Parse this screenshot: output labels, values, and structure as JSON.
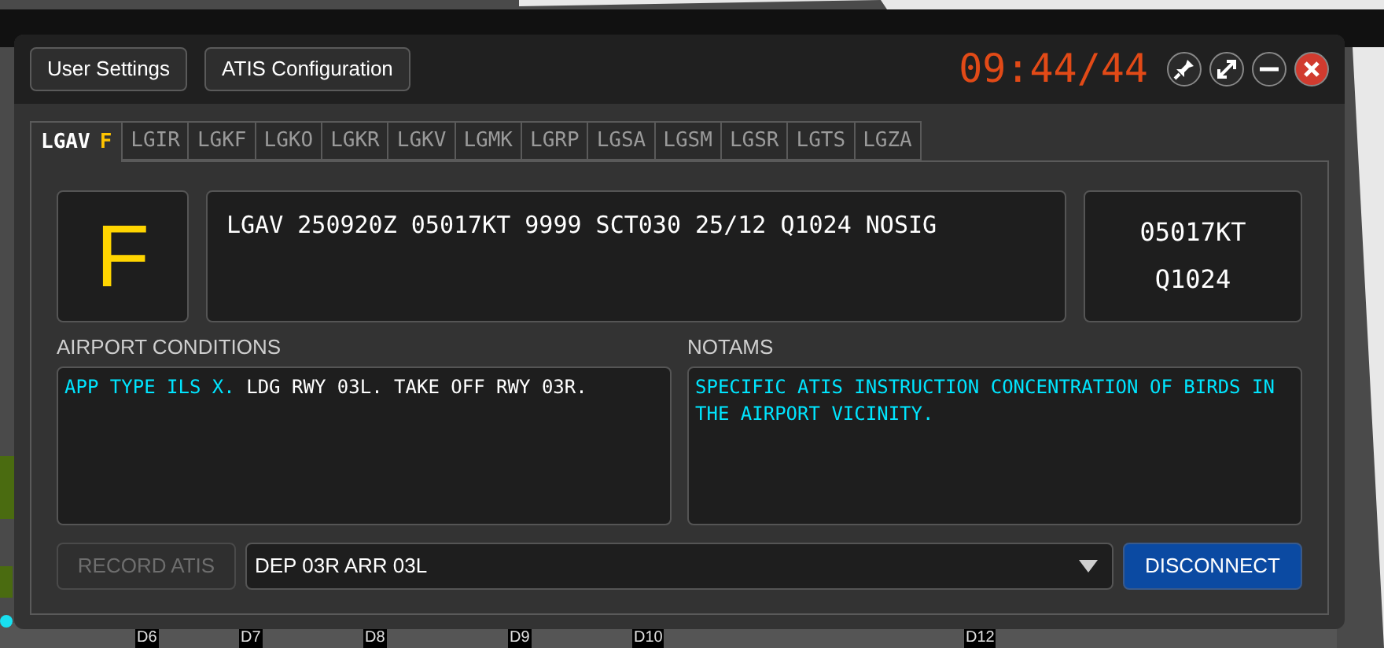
{
  "background": {
    "map_labels": [
      "D6",
      "D7",
      "D8",
      "D9",
      "D10",
      "D12"
    ]
  },
  "toolbar": {
    "buttons": [
      "User Settings",
      "ATIS Configuration"
    ],
    "clock": "09:44/44",
    "window_controls": [
      {
        "kind": "pin"
      },
      {
        "kind": "maximize"
      },
      {
        "kind": "minimize"
      },
      {
        "kind": "close"
      }
    ]
  },
  "tabs": [
    {
      "label": "LGAV",
      "letter": "F",
      "selected": true
    },
    {
      "label": "LGIR",
      "selected": false
    },
    {
      "label": "LGKF",
      "selected": false
    },
    {
      "label": "LGKO",
      "selected": false
    },
    {
      "label": "LGKR",
      "selected": false
    },
    {
      "label": "LGKV",
      "selected": false
    },
    {
      "label": "LGMK",
      "selected": false
    },
    {
      "label": "LGRP",
      "selected": false
    },
    {
      "label": "LGSA",
      "selected": false
    },
    {
      "label": "LGSM",
      "selected": false
    },
    {
      "label": "LGSR",
      "selected": false
    },
    {
      "label": "LGTS",
      "selected": false
    },
    {
      "label": "LGZA",
      "selected": false
    }
  ],
  "atis_letter": "F",
  "metar": "LGAV 250920Z 05017KT 9999 SCT030 25/12 Q1024 NOSIG",
  "wind": "05017KT",
  "qnh": "Q1024",
  "airport_conditions": {
    "label": "AIRPORT CONDITIONS",
    "segments": [
      {
        "text": "APP TYPE ILS X.",
        "color": "#00e5ff"
      },
      {
        "text": "LDG RWY 03L. TAKE OFF RWY 03R.",
        "color": "#ffffff"
      }
    ]
  },
  "notams": {
    "label": "NOTAMS",
    "text": "SPECIFIC ATIS INSTRUCTION CONCENTRATION OF BIRDS IN THE AIRPORT VICINITY."
  },
  "record_button": {
    "label": "RECORD ATIS",
    "disabled": true
  },
  "runway_select": {
    "value": "DEP 03R ARR 03L"
  },
  "disconnect_button": {
    "label": "DISCONNECT"
  }
}
